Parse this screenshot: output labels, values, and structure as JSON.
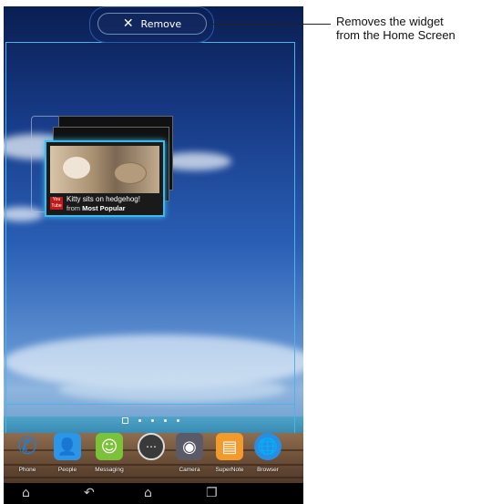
{
  "top_bar": {
    "remove_label": "Remove",
    "remove_icon": "close-icon"
  },
  "callout": {
    "line1": "Removes the widget",
    "line2": "from the Home Screen"
  },
  "widget": {
    "source_badge": "You Tube",
    "title": "Kitty sits on hedgehog!",
    "from_prefix": "from",
    "from_bold": "Most Popular"
  },
  "page_indicator": {
    "count": 5,
    "active_index": 0
  },
  "dock": [
    {
      "label": "Phone",
      "icon": "phone-icon",
      "color": "#1f7fd8"
    },
    {
      "label": "People",
      "icon": "people-icon",
      "color": "#2d95e8"
    },
    {
      "label": "Messaging",
      "icon": "messaging-icon",
      "color": "#7bc13a"
    },
    {
      "label": "",
      "icon": "all-apps-icon",
      "color": "#3a3a3a"
    },
    {
      "label": "Camera",
      "icon": "camera-icon",
      "color": "#5a5a68"
    },
    {
      "label": "SuperNote",
      "icon": "supernote-icon",
      "color": "#f39a2a"
    },
    {
      "label": "Browser",
      "icon": "browser-icon",
      "color": "#2a8de0"
    }
  ],
  "nav": {
    "home_up": "home-up-icon",
    "back": "back-icon",
    "home": "home-icon",
    "recents": "recents-icon"
  },
  "colors": {
    "accent": "#3fb8ea"
  }
}
